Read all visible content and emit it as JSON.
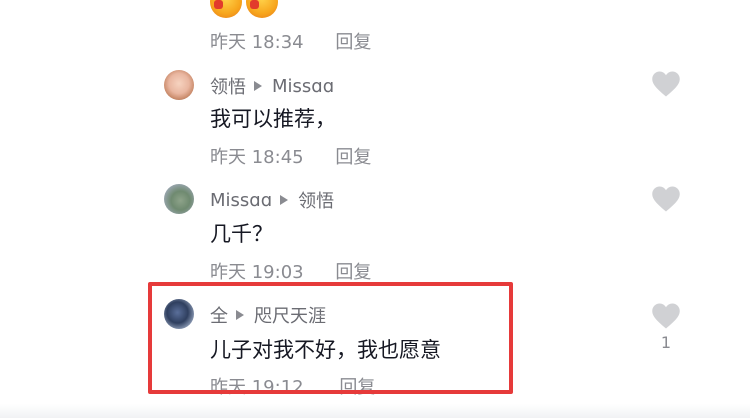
{
  "comments": [
    {
      "time": "昨天 18:34",
      "reply": "回复"
    },
    {
      "author": "领悟",
      "to": "Missɑɑ",
      "text": "我可以推荐，",
      "time": "昨天 18:45",
      "reply": "回复"
    },
    {
      "author": "Missɑɑ",
      "to": "领悟",
      "text": "几千？",
      "time": "昨天 19:03",
      "reply": "回复"
    },
    {
      "author": "全",
      "to": "咫尺天涯",
      "text": "儿子对我不好，我也愿意",
      "time": "昨天 19:12",
      "reply": "回复",
      "likes": "1"
    }
  ],
  "colors": {
    "highlight": "#e63a3a",
    "meta": "#8a8b91",
    "heart": "#d0d1d4"
  },
  "icons": [
    "heart-icon",
    "reply-arrow-icon",
    "emoji-icon"
  ]
}
